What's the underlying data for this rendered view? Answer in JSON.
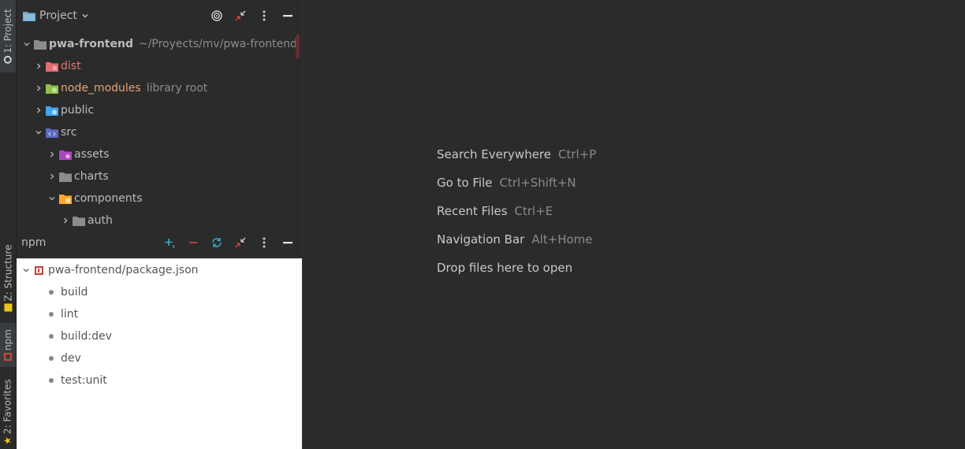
{
  "strip": {
    "project_tab": "1: Project",
    "structure_tab": "Z: Structure",
    "npm_tab": "npm",
    "favorites_tab": "2: Favorites"
  },
  "project": {
    "title": "Project",
    "root": {
      "name": "pwa-frontend",
      "path": "~/Proyects/mv/pwa-frontend"
    },
    "items": [
      {
        "label": "dist",
        "hint": "",
        "color": "#e07a6c",
        "folder_color": "#e06c75"
      },
      {
        "label": "node_modules",
        "hint": "library root",
        "color": "#e8a177",
        "folder_color": "#8dc149"
      },
      {
        "label": "public",
        "hint": "",
        "color": "#bbbbbb",
        "folder_color": "#42a5f5"
      },
      {
        "label": "src",
        "hint": "",
        "color": "#bbbbbb",
        "folder_color": "#5c6bc0"
      },
      {
        "label": "assets",
        "hint": "",
        "color": "#bbbbbb",
        "folder_color": "#ab47bc"
      },
      {
        "label": "charts",
        "hint": "",
        "color": "#bbbbbb",
        "folder_color": "#8c8c8c"
      },
      {
        "label": "components",
        "hint": "",
        "color": "#bbbbbb",
        "folder_color": "#ffa726"
      },
      {
        "label": "auth",
        "hint": "",
        "color": "#bbbbbb",
        "folder_color": "#8c8c8c"
      }
    ]
  },
  "npm": {
    "title": "npm",
    "package": "pwa-frontend/package.json",
    "scripts": [
      "build",
      "lint",
      "build:dev",
      "dev",
      "test:unit"
    ]
  },
  "editor": {
    "hints": [
      {
        "action": "Search Everywhere",
        "shortcut": "Ctrl+P"
      },
      {
        "action": "Go to File",
        "shortcut": "Ctrl+Shift+N"
      },
      {
        "action": "Recent Files",
        "shortcut": "Ctrl+E"
      },
      {
        "action": "Navigation Bar",
        "shortcut": "Alt+Home"
      },
      {
        "action": "Drop files here to open",
        "shortcut": ""
      }
    ]
  }
}
